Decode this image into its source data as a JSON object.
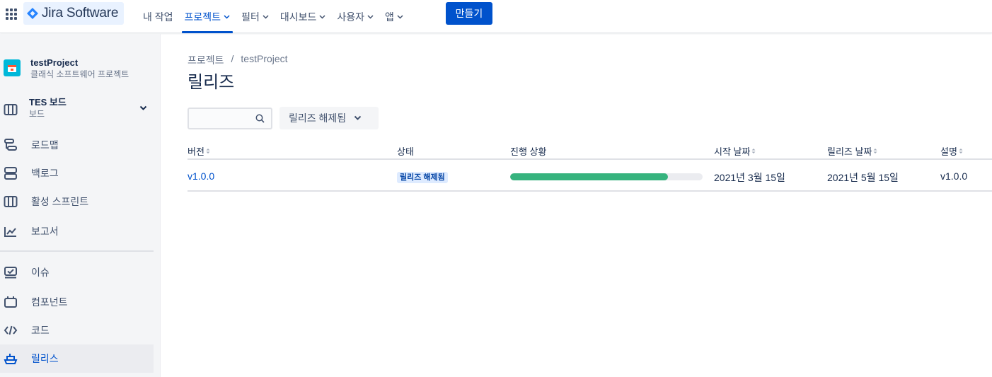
{
  "topnav": {
    "logo_text": "Jira Software",
    "items": [
      {
        "label": "내 작업",
        "has_chevron": false,
        "active": false
      },
      {
        "label": "프로젝트",
        "has_chevron": true,
        "active": true
      },
      {
        "label": "필터",
        "has_chevron": true,
        "active": false
      },
      {
        "label": "대시보드",
        "has_chevron": true,
        "active": false
      },
      {
        "label": "사용자",
        "has_chevron": true,
        "active": false
      },
      {
        "label": "앱",
        "has_chevron": true,
        "active": false
      }
    ],
    "create_label": "만들기"
  },
  "sidebar": {
    "project_name": "testProject",
    "project_type": "클래식 소프트웨어 프로젝트",
    "board_name": "TES 보드",
    "board_sub": "보드",
    "items": [
      {
        "label": "로드맵",
        "icon": "roadmap-icon"
      },
      {
        "label": "백로그",
        "icon": "backlog-icon"
      },
      {
        "label": "활성 스프린트",
        "icon": "board-columns-icon"
      },
      {
        "label": "보고서",
        "icon": "reports-icon"
      },
      {
        "label": "이슈",
        "icon": "issues-icon"
      },
      {
        "label": "컴포넌트",
        "icon": "components-icon"
      },
      {
        "label": "코드",
        "icon": "code-icon"
      },
      {
        "label": "릴리스",
        "icon": "ship-icon",
        "active": true
      }
    ]
  },
  "breadcrumb": {
    "parent": "프로젝트",
    "separator": "/",
    "current": "testProject"
  },
  "page_title": "릴리즈",
  "search": {
    "value": "",
    "placeholder": ""
  },
  "filter": {
    "label": "릴리즈 해제됨"
  },
  "table": {
    "columns": [
      "버전",
      "상태",
      "진행 상황",
      "시작 날짜",
      "릴리즈 날짜",
      "설명"
    ],
    "rows": [
      {
        "version": "v1.0.0",
        "status": "릴리즈 해제됨",
        "progress": 0.82,
        "start_date": "2021년 3월 15일",
        "release_date": "2021년 5월 15일",
        "description": "v1.0.0"
      }
    ]
  },
  "colors": {
    "accent": "#0052cc",
    "progress": "#36b37e",
    "lozenge_bg": "#deebff"
  }
}
